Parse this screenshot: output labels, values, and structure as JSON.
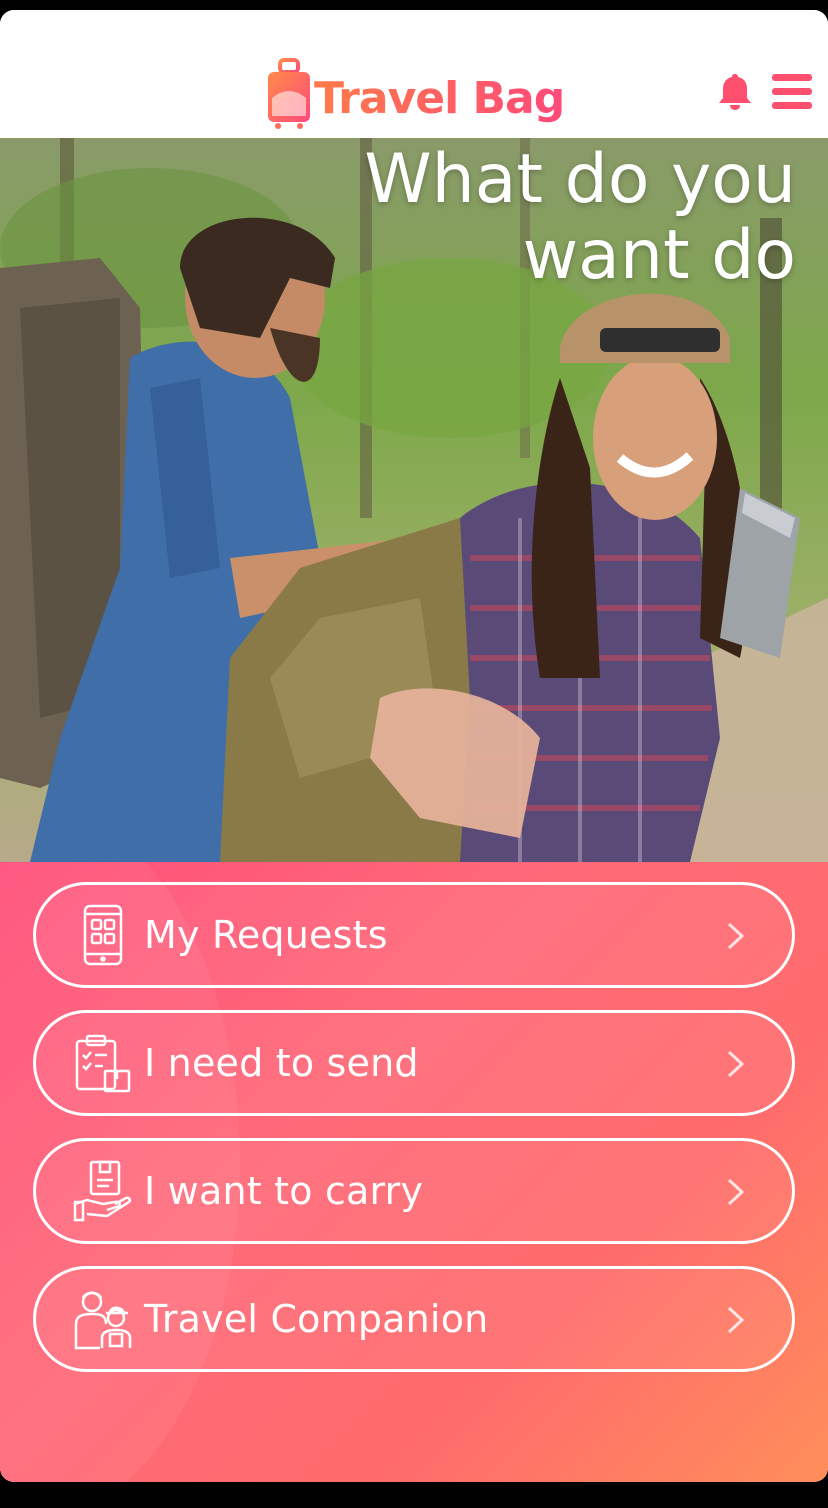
{
  "header": {
    "app_name": "Travel Bag",
    "logo_icon": "suitcase-logo-icon",
    "notification_icon": "bell-icon",
    "menu_icon": "hamburger-menu-icon"
  },
  "hero": {
    "headline_line1": "What do you",
    "headline_line2": "want do",
    "image": "couple-hiking-with-backpacks-photo"
  },
  "menu": {
    "items": [
      {
        "label": "My Requests",
        "icon": "phone-grid-icon"
      },
      {
        "label": "I need to send",
        "icon": "clipboard-package-icon"
      },
      {
        "label": "I want to carry",
        "icon": "hand-holding-box-icon"
      },
      {
        "label": "Travel Companion",
        "icon": "two-travelers-icon"
      }
    ]
  },
  "colors": {
    "brand": "#ff5e6e",
    "panel_start": "#ff4f7a",
    "panel_end": "#ff8e5a",
    "button_border": "#ffffff"
  }
}
